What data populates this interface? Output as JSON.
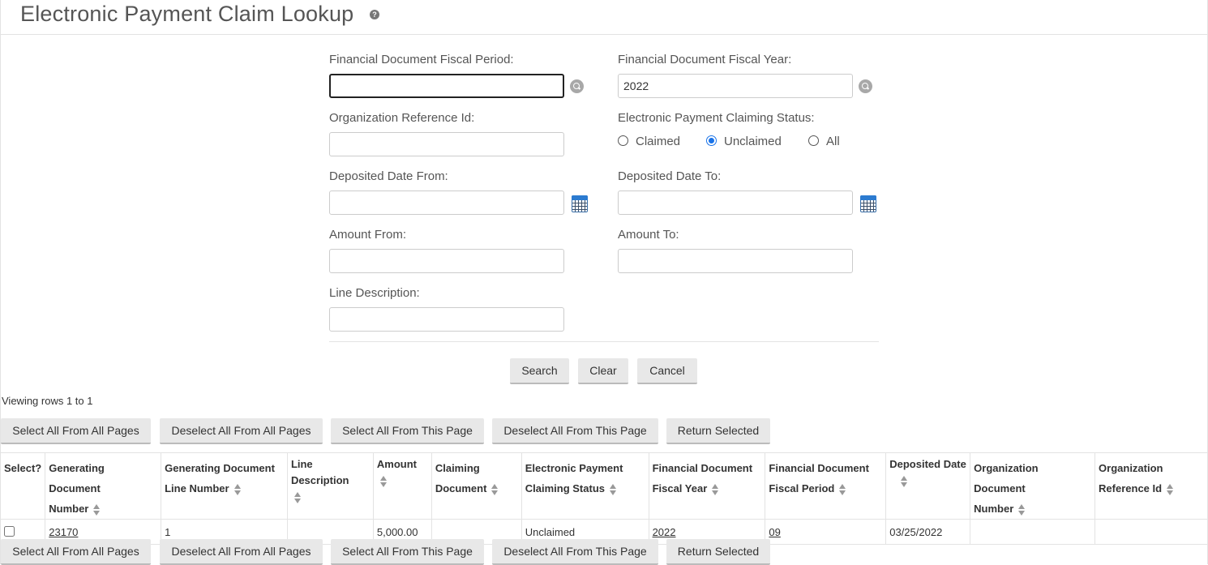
{
  "page": {
    "title": "Electronic Payment Claim Lookup",
    "help_icon": "?"
  },
  "form": {
    "fiscal_period_label": "Financial Document Fiscal Period:",
    "fiscal_period_value": "",
    "fiscal_year_label": "Financial Document Fiscal Year:",
    "fiscal_year_value": "2022",
    "org_ref_label": "Organization Reference Id:",
    "org_ref_value": "",
    "claim_status_label": "Electronic Payment Claiming Status:",
    "claim_status_options": [
      "Claimed",
      "Unclaimed",
      "All"
    ],
    "claim_status_selected": "Unclaimed",
    "deposited_from_label": "Deposited Date From:",
    "deposited_from_value": "",
    "deposited_to_label": "Deposited Date To:",
    "deposited_to_value": "",
    "amount_from_label": "Amount From:",
    "amount_from_value": "",
    "amount_to_label": "Amount To:",
    "amount_to_value": "",
    "line_desc_label": "Line Description:",
    "line_desc_value": ""
  },
  "actions": {
    "search": "Search",
    "clear": "Clear",
    "cancel": "Cancel"
  },
  "results": {
    "rows_info": "Viewing rows 1 to 1",
    "buttons": {
      "select_all_pages": "Select All From All Pages",
      "deselect_all_pages": "Deselect All From All Pages",
      "select_all_this_page": "Select All From This Page",
      "deselect_all_this_page": "Deselect All From This Page",
      "return_selected": "Return Selected"
    },
    "columns": [
      "Select?",
      "Generating Document Number",
      "Generating Document Line Number",
      "Line Description",
      "Amount",
      "Claiming Document",
      "Electronic Payment Claiming Status",
      "Financial Document Fiscal Year",
      "Financial Document Fiscal Period",
      "Deposited Date",
      "Organization Document Number",
      "Organization Reference Id"
    ],
    "column_lines": [
      [
        "Select?"
      ],
      [
        "Generating Document",
        "Number"
      ],
      [
        "Generating Document",
        "Line Number"
      ],
      [
        "Line",
        "Description"
      ],
      [
        "Amount"
      ],
      [
        "Claiming",
        "Document"
      ],
      [
        "Electronic Payment",
        "Claiming Status"
      ],
      [
        "Financial Document",
        "Fiscal Year"
      ],
      [
        "Financial Document",
        "Fiscal Period"
      ],
      [
        "Deposited Date"
      ],
      [
        "Organization Document",
        "Number"
      ],
      [
        "Organization",
        "Reference Id"
      ]
    ],
    "rows": [
      {
        "selected": false,
        "generating_doc_number": "23170",
        "generating_doc_line": "1",
        "line_description": "",
        "amount": "5,000.00",
        "claiming_document": "",
        "claiming_status": "Unclaimed",
        "fiscal_year": "2022",
        "fiscal_period": "09",
        "deposited_date": "03/25/2022",
        "org_doc_number": "",
        "org_ref_id": ""
      }
    ]
  },
  "icons": {
    "help": "help-icon",
    "lookup": "search-icon",
    "calendar": "calendar-icon",
    "sort": "sort-icon"
  },
  "colors": {
    "button_bg": "#e8e8e8",
    "border": "#e3e3e3",
    "radio_selected": "#1a73e8",
    "calendar_blue": "#2c7bd0"
  }
}
